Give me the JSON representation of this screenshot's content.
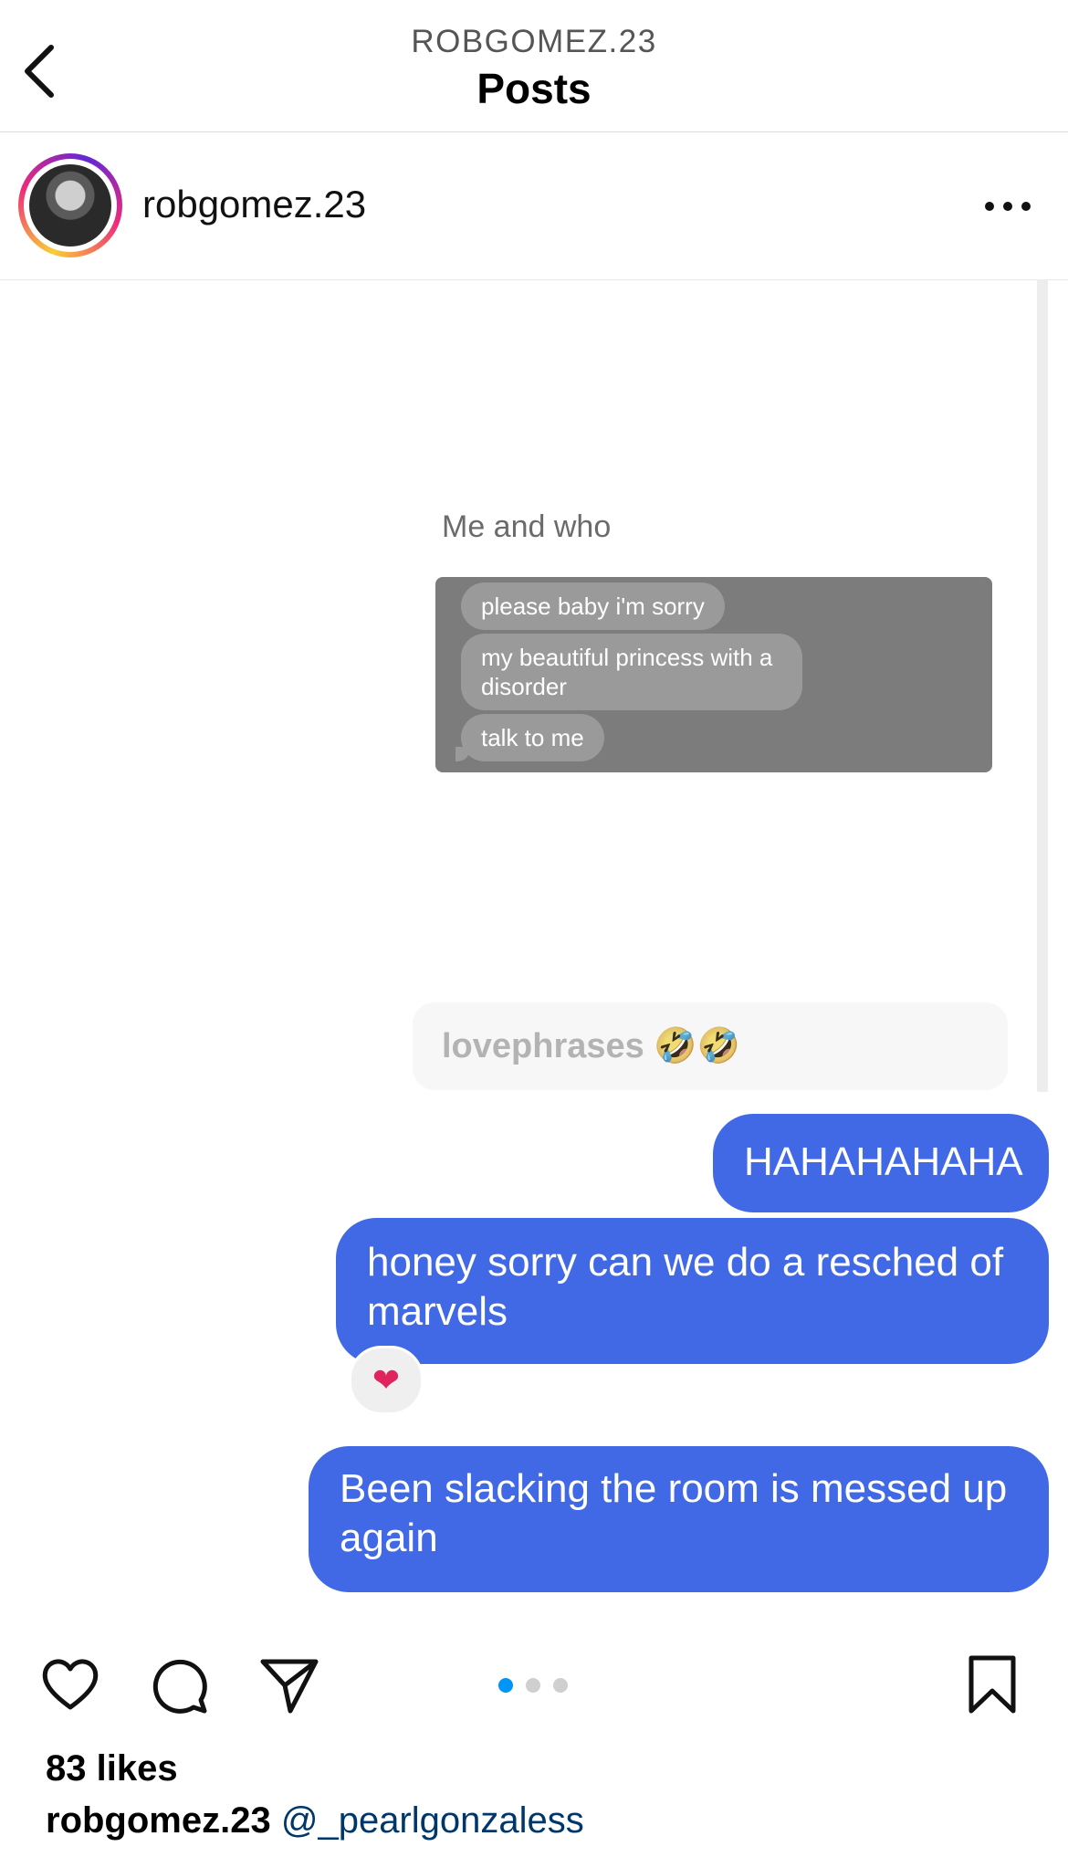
{
  "header": {
    "subtitle": "ROBGOMEZ.23",
    "title": "Posts"
  },
  "profile": {
    "username": "robgomez.23"
  },
  "post": {
    "screenshot_caption": "Me and who",
    "screenshot_messages": [
      "please baby i'm sorry",
      "my beautiful princess with a disorder",
      "talk to me"
    ],
    "reply_preview": {
      "text": "lovephrases",
      "emoji": "🤣🤣"
    },
    "messages": [
      "HAHAHAHAHA",
      "honey sorry can we do a resched of marvels",
      "Been slacking the room is messed up again"
    ],
    "reaction": "❤",
    "carousel": {
      "count": 3,
      "active": 1
    }
  },
  "footer": {
    "likes": "83 likes",
    "caption_user": "robgomez.23",
    "caption_mention": "@_pearlgonzaless"
  },
  "colors": {
    "bubble_blue": "#4169e6",
    "mention": "#00376b",
    "carousel_active": "#0095f6"
  }
}
